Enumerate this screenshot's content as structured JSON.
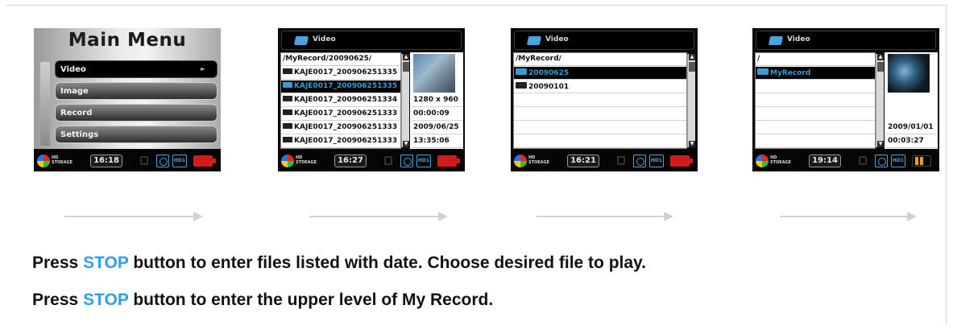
{
  "screens": [
    {
      "type": "main-menu",
      "title": "Main Menu",
      "items": [
        "Video",
        "Image",
        "Record",
        "Settings"
      ],
      "selected_index": 0,
      "selected_arrow": "►",
      "status": {
        "hd_text": "HD\nSTOEAGE",
        "time": "16:18",
        "battery": "red"
      }
    },
    {
      "type": "file-list",
      "header_title": "Video",
      "path": "/MyRecord/20090625/",
      "rows": [
        {
          "text": "KAJE0017_200906251335",
          "kind": "file"
        },
        {
          "text": "KAJE0017_200906251335",
          "kind": "file",
          "selected": true
        },
        {
          "text": "KAJE0017_200906251334",
          "kind": "file"
        },
        {
          "text": "KAJE0017_200906251333",
          "kind": "file"
        },
        {
          "text": "KAJE0017_200906251333",
          "kind": "file"
        },
        {
          "text": "KAJE0017_200906251333",
          "kind": "file"
        }
      ],
      "info": [
        "1280 x 960",
        "00:00:09",
        "2009/06/25",
        "13:35:06"
      ],
      "status": {
        "hd_text": "HD\nSTOEAGE",
        "time": "16:27",
        "battery": "red"
      }
    },
    {
      "type": "folder-list",
      "header_title": "Video",
      "path": "/MyRecord/",
      "rows": [
        {
          "text": "20090625",
          "kind": "folder",
          "selected": true
        },
        {
          "text": "20090101",
          "kind": "folder"
        }
      ],
      "status": {
        "hd_text": "HD\nSTOEAGE",
        "time": "16:21",
        "battery": "red"
      }
    },
    {
      "type": "folder-list",
      "header_title": "Video",
      "path": "/",
      "rows": [
        {
          "text": "MyRecord",
          "kind": "folder",
          "selected": true
        }
      ],
      "info": [
        "2009/01/01",
        "00:03:27"
      ],
      "status": {
        "hd_text": "HD\nSTOEAGE",
        "time": "19:14",
        "battery": "orange"
      }
    }
  ],
  "status_hd_label": "HD1",
  "captions": [
    {
      "pre": "Press ",
      "keyword": "STOP",
      "post": " button to enter files listed with date. Choose desired file to play."
    },
    {
      "pre": "Press ",
      "keyword": "STOP",
      "post": " button to enter the upper level of My Record."
    }
  ],
  "colors": {
    "keyword": "#2fa1e8",
    "selection": "#3b9bd6",
    "battery_red": "#d21b1b"
  }
}
